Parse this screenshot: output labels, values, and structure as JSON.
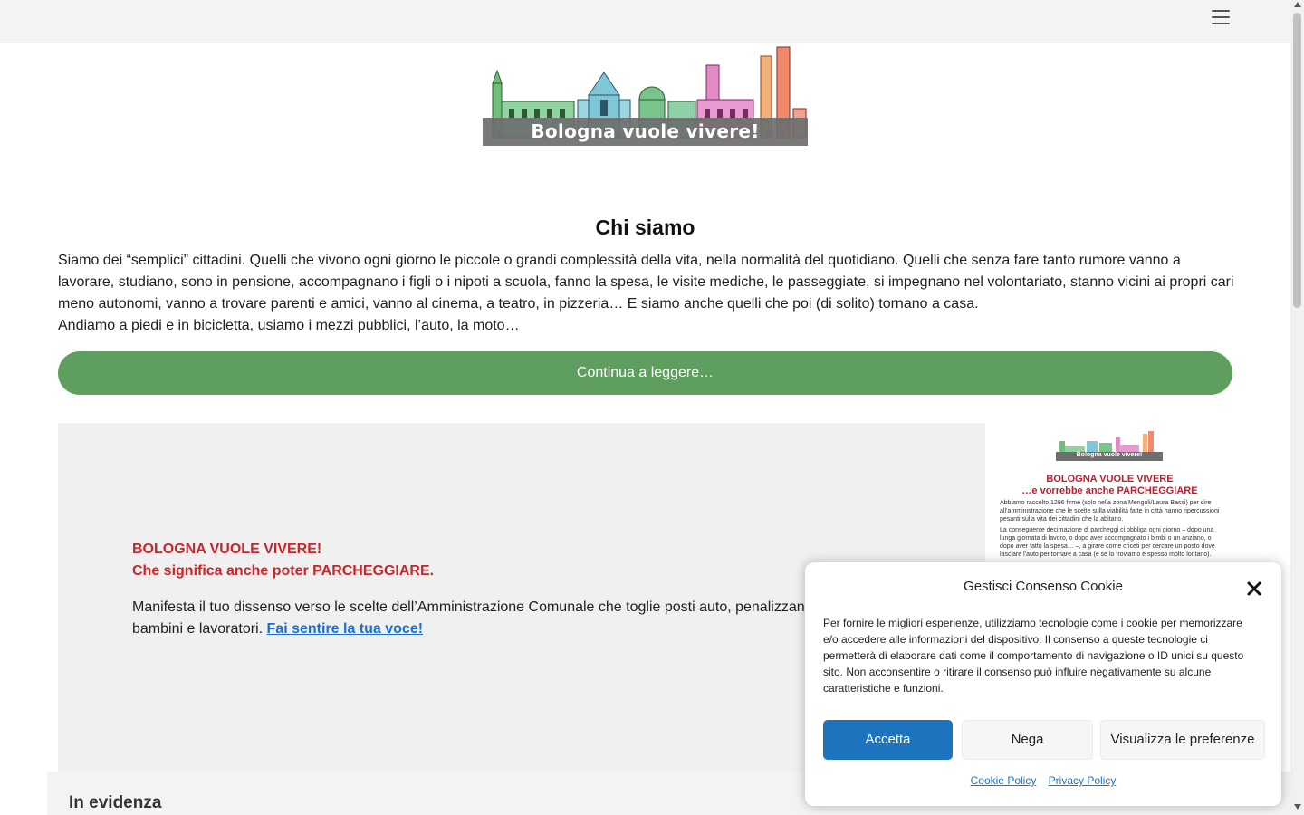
{
  "header": {
    "menu_icon": "hamburger-menu-icon"
  },
  "logo": {
    "text": "Bologna vuole vivere!"
  },
  "about": {
    "title": "Chi siamo",
    "paragraph1": "Siamo dei “semplici” cittadini. Quelli che vivono ogni giorno le piccole o grandi complessità della vita, nella normalità del quotidiano. Quelli che senza fare tanto rumore vanno a lavorare, studiano, sono in pensione, accompagnano i figli o i nipoti a scuola, fanno la spesa, le visite mediche, le passeggiate, si impegnano nel volontariato, stanno vicini ai propri cari meno autonomi, vanno a trovare parenti e amici, vanno al cinema, a teatro, in pizzeria… E siamo anche quelli che poi (di solito) tornano a casa.",
    "paragraph2": "Andiamo a piedi e in bicicletta, usiamo i mezzi pubblici, l’auto, la moto…",
    "cta_label": "Continua a leggere…"
  },
  "promo": {
    "heading_line1": "BOLOGNA VUOLE VIVERE!",
    "heading_line2": "Che significa anche poter PARCHEGGIARE.",
    "body_text": "Manifesta il tuo dissenso verso le scelte dell’Amministrazione Comunale che toglie posti auto, penalizzando famiglie con bambini e lavoratori.",
    "link_text": "Fai sentire la tua voce!"
  },
  "flyer": {
    "logo_text": "Bologna vuole vivere!",
    "heading1": "BOLOGNA VUOLE VIVERE",
    "heading2": "…e vorrebbe anche PARCHEGGIARE",
    "text1": "Abbiamo raccolto 1296 firme (solo nella zona Mengoli/Laura Bassi) per dire all’amministrazione che le scelte sulla viabilità fatte in città hanno ripercussioni pesanti sulla vita dei cittadini che la abitano.",
    "text2": "La conseguente decimazione di parcheggi ci obbliga ogni giorno – dopo una lunga giornata di lavoro, o dopo aver accompagnato i bimbi o un anziano, o dopo aver fatto la spesa… –, a girare come criceti per cercare un posto dove lasciare l’auto per tornare a casa (e se lo troviamo è spesso molto lontano)."
  },
  "featured": {
    "title": "In evidenza"
  },
  "cookie": {
    "title": "Gestisci Consenso Cookie",
    "text": "Per fornire le migliori esperienze, utilizziamo tecnologie come i cookie per memorizzare e/o accedere alle informazioni del dispositivo. Il consenso a queste tecnologie ci permetterà di elaborare dati come il comportamento di navigazione o ID unici su questo sito. Non acconsentire o ritirare il consenso può influire negativamente su alcune caratteristiche e funzioni.",
    "accept_label": "Accetta",
    "deny_label": "Nega",
    "prefs_label": "Visualizza le preferenze",
    "cookie_policy_label": "Cookie Policy",
    "privacy_policy_label": "Privacy Policy"
  },
  "colors": {
    "cta_green": "#5e9e5e",
    "promo_red": "#c8262a",
    "accept_blue": "#1e73be"
  }
}
